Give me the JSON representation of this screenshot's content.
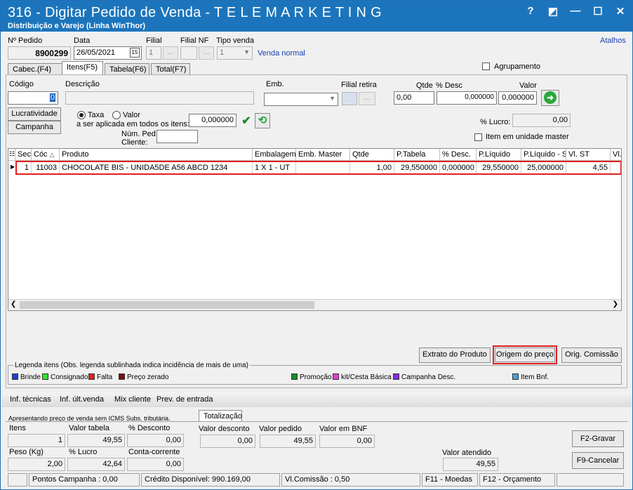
{
  "window": {
    "title": "316 - Digitar Pedido de Venda - T E L E M A R K E T I N G",
    "subtitle": "Distribuição e Varejo (Linha WinThor)",
    "help_icon": "?",
    "maximize_icon": "◩",
    "minimize_icon": "—",
    "restore_icon": "☐",
    "close_icon": "✕"
  },
  "header": {
    "pedido_label": "Nº Pedido",
    "pedido_value": "8900299",
    "data_label": "Data",
    "data_value": "26/05/2021",
    "calendar_icon": "15",
    "filial_label": "Filial",
    "filial_value": "1",
    "filial_nf_label": "Filial NF",
    "dots": "...",
    "tipo_venda_label": "Tipo venda",
    "tipo_venda_value": "1",
    "tipo_venda_text": "Venda normal",
    "atalhos": "Atalhos"
  },
  "tabs": [
    {
      "label": "Cabec.(F4)"
    },
    {
      "label": "Itens(F5)"
    },
    {
      "label": "Tabela(F6)"
    },
    {
      "label": "Total(F7)"
    }
  ],
  "itens": {
    "agrupamento": "Agrupamento",
    "codigo_label": "Código",
    "codigo_value": "0",
    "descricao_label": "Descrição",
    "emb_label": "Emb.",
    "filial_retira_label": "Filial retira",
    "qtde_label": "Qtde",
    "qtde_value": "0,00",
    "desc_label": "% Desc",
    "desc_value": "0,000000",
    "valor_label": "Valor",
    "valor_value": "0,000000",
    "lucratividade": "Lucratividade",
    "campanha": "Campanha",
    "taxa": "Taxa",
    "valor_radio": "Valor",
    "aplicada": "a ser aplicada em todos os itens:",
    "aplicada_value": "0,000000",
    "lucro_label": "% Lucro:",
    "lucro_value": "0,00",
    "num_ped_label": "Núm. Ped.",
    "cliente_label": "Cliente:",
    "item_master": "Item em unidade master"
  },
  "grid": {
    "headers": [
      "Sec",
      "Cóc",
      "Produto",
      "Embalagem",
      "Emb. Master",
      "Qtde",
      "P.Tabela",
      "% Desc.",
      "P.Líquido",
      "P.Líquido - S",
      "Vl. ST",
      "Vl."
    ],
    "sort_icon": "△",
    "row": [
      "1",
      "11003",
      "CHOCOLATE BIS - UNIDA5DE A56 ABCD 1234",
      "1 X 1 - UT",
      "",
      "1,00",
      "29,550000",
      "0,000000",
      "29,550000",
      "25,000000",
      "4,55"
    ]
  },
  "buttons": {
    "extrato": "Extrato do Produto",
    "origem": "Origem do preço",
    "comissao": "Orig. Comissão"
  },
  "legend": {
    "title": "Legenda itens (Obs. legenda sublinhada indica incidência de mais de uma)",
    "items": [
      {
        "label": "Brinde",
        "color": "#1f3fd6"
      },
      {
        "label": "Consignado",
        "color": "#2ee62e"
      },
      {
        "label": "Falta",
        "color": "#e61e1e"
      },
      {
        "label": "Preço zerado",
        "color": "#7a1010"
      },
      {
        "label": "Promoção",
        "color": "#1c8a2a"
      },
      {
        "label": "kit/Cesta Básica",
        "color": "#e83cd8"
      },
      {
        "label": "Campanha Desc.",
        "color": "#8a2be2"
      },
      {
        "label": "Item Bnf.",
        "color": "#4a9fe0"
      }
    ]
  },
  "infobar": [
    "Inf. técnicas",
    "Inf. últ.venda",
    "Mix cliente",
    "Prev. de entrada"
  ],
  "totals": {
    "note": "Apresentando preço de venda sem ICMS Subs. tributária.",
    "tab": "Totalização",
    "itens_label": "Itens",
    "itens_value": "1",
    "valor_tabela_label": "Valor tabela",
    "valor_tabela_value": "49,55",
    "pct_desconto_label": "% Desconto",
    "pct_desconto_value": "0,00",
    "valor_desconto_label": "Valor desconto",
    "valor_desconto_value": "0,00",
    "valor_pedido_label": "Valor pedido",
    "valor_pedido_value": "49,55",
    "valor_bnf_label": "Valor em BNF",
    "valor_bnf_value": "0,00",
    "peso_label": "Peso (Kg)",
    "peso_value": "2,00",
    "pct_lucro_label": "% Lucro",
    "pct_lucro_value": "42,64",
    "conta_label": "Conta-corrente",
    "conta_value": "0,00",
    "valor_atendido_label": "Valor atendido",
    "valor_atendido_value": "49,55",
    "gravar": "F2-Gravar",
    "cancelar": "F9-Cancelar"
  },
  "status": {
    "pontos": "Pontos Campanha : 0,00",
    "credito": "Crédito Disponível: 990.169,00",
    "comissao": "Vl.Comissão : 0,50",
    "moedas": "F11 - Moedas",
    "orcamento": "F12 - Orçamento"
  }
}
